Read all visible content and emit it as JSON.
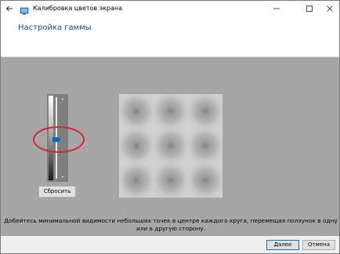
{
  "window": {
    "title": "Калибровка цветов экрана",
    "controls": {
      "minimize": "—",
      "maximize": "☐",
      "close": "✕"
    }
  },
  "header": {
    "heading": "Настройка гаммы"
  },
  "gamma": {
    "reset_label": "Сбросить",
    "slider_position": 0.5
  },
  "instruction": "Добейтесь минимальной видимости небольших точек в центре каждого круга, перемещая ползунок в одну или в другую сторону.",
  "footer": {
    "next_label": "Далее",
    "cancel_label": "Отмена"
  },
  "colors": {
    "accent": "#0a64c8",
    "highlight": "#d9242b",
    "heading": "#1a4a8f",
    "background": "#a6a6a6"
  }
}
